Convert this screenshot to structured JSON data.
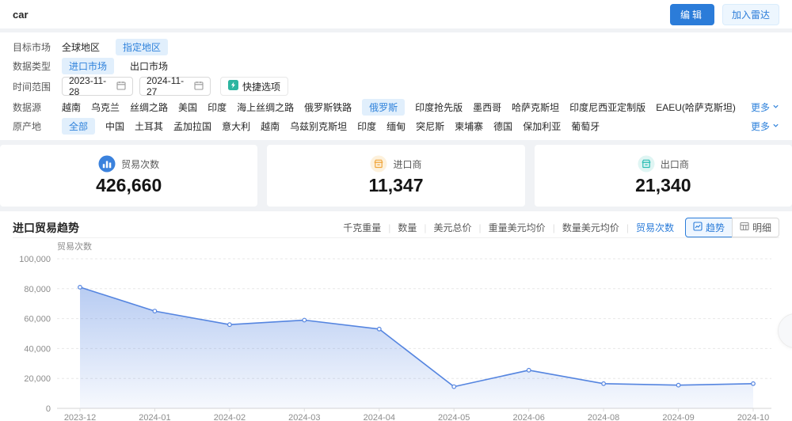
{
  "header": {
    "title": "car",
    "edit_button": "编辑",
    "add_radar_button": "加入雷达"
  },
  "filters": {
    "target_market": {
      "label": "目标市场",
      "options": [
        {
          "text": "全球地区",
          "active": false
        },
        {
          "text": "指定地区",
          "active": true
        }
      ]
    },
    "data_type": {
      "label": "数据类型",
      "options": [
        {
          "text": "进口市场",
          "active": true
        },
        {
          "text": "出口市场",
          "active": false
        }
      ]
    },
    "time_range": {
      "label": "时间范围",
      "start": "2023-11-28",
      "end": "2024-11-27",
      "quick_button": "快捷选项"
    },
    "data_source": {
      "label": "数据源",
      "more": "更多",
      "options": [
        {
          "text": "越南"
        },
        {
          "text": "乌克兰"
        },
        {
          "text": "丝绸之路"
        },
        {
          "text": "美国"
        },
        {
          "text": "印度"
        },
        {
          "text": "海上丝绸之路"
        },
        {
          "text": "俄罗斯铁路"
        },
        {
          "text": "俄罗斯",
          "active": true
        },
        {
          "text": "印度抢先版"
        },
        {
          "text": "墨西哥"
        },
        {
          "text": "哈萨克斯坦"
        },
        {
          "text": "印度尼西亚定制版"
        },
        {
          "text": "EAEU(哈萨克斯坦)"
        }
      ]
    },
    "origin": {
      "label": "原产地",
      "more": "更多",
      "options": [
        {
          "text": "全部",
          "active": true
        },
        {
          "text": "中国"
        },
        {
          "text": "土耳其"
        },
        {
          "text": "孟加拉国"
        },
        {
          "text": "意大利"
        },
        {
          "text": "越南"
        },
        {
          "text": "乌兹别克斯坦"
        },
        {
          "text": "印度"
        },
        {
          "text": "缅甸"
        },
        {
          "text": "突尼斯"
        },
        {
          "text": "柬埔寨"
        },
        {
          "text": "德国"
        },
        {
          "text": "保加利亚"
        },
        {
          "text": "葡萄牙"
        }
      ]
    }
  },
  "stats": [
    {
      "icon": "bar-chart-icon",
      "label": "贸易次数",
      "value": "426,660",
      "color": "#3b82dd"
    },
    {
      "icon": "importer-icon",
      "label": "进口商",
      "value": "11,347",
      "color": "#f0a63c"
    },
    {
      "icon": "exporter-icon",
      "label": "出口商",
      "value": "21,340",
      "color": "#2bbdb4"
    }
  ],
  "trend": {
    "title": "进口贸易趋势",
    "metrics": [
      {
        "text": "千克重量"
      },
      {
        "text": "数量"
      },
      {
        "text": "美元总价"
      },
      {
        "text": "重量美元均价"
      },
      {
        "text": "数量美元均价"
      },
      {
        "text": "贸易次数",
        "active": true
      }
    ],
    "trend_button": "趋势",
    "detail_button": "明细"
  },
  "chart_data": {
    "type": "area",
    "title": "进口贸易趋势",
    "ylabel": "贸易次数",
    "categories": [
      "2023-12",
      "2024-01",
      "2024-02",
      "2024-03",
      "2024-04",
      "2024-05",
      "2024-06",
      "2024-08",
      "2024-09",
      "2024-10"
    ],
    "values": [
      81000,
      65000,
      56000,
      59000,
      53000,
      14500,
      25500,
      16500,
      15500,
      16500
    ],
    "ylim": [
      0,
      100000
    ],
    "yticks": [
      0,
      20000,
      40000,
      60000,
      80000,
      100000
    ],
    "grid": true,
    "line_color": "#5585e0",
    "area_opacity_top": 0.42,
    "area_opacity_bottom": 0.05
  }
}
